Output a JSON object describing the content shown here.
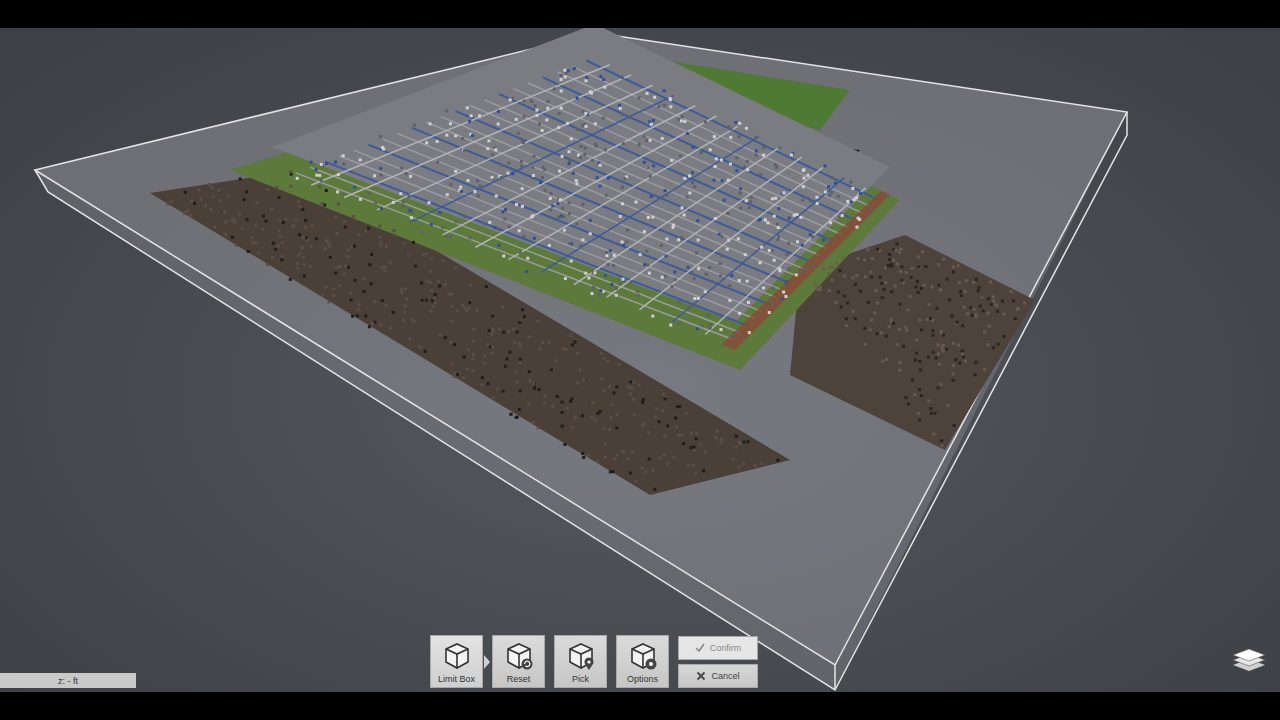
{
  "viewport": {
    "status": "z: - ft"
  },
  "toolbar": {
    "tools": [
      {
        "label": "Limit Box",
        "selected": true
      },
      {
        "label": "Reset",
        "selected": false
      },
      {
        "label": "Pick",
        "selected": false
      },
      {
        "label": "Options",
        "selected": false
      }
    ],
    "actions": [
      {
        "label": "Confirm",
        "kind": "confirm",
        "hovered": true
      },
      {
        "label": "Cancel",
        "kind": "cancel",
        "hovered": false
      }
    ]
  }
}
